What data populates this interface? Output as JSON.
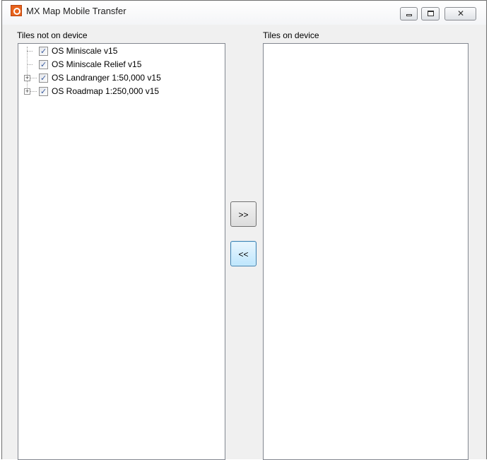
{
  "window": {
    "title": "MX Map Mobile Transfer",
    "icon": "app-icon",
    "controls": [
      "minimize-icon",
      "maximize-icon",
      "close-icon"
    ]
  },
  "left_panel": {
    "label": "Tiles not on device",
    "items": [
      {
        "label": "OS Miniscale v15",
        "checked": true,
        "expandable": false
      },
      {
        "label": "OS Miniscale Relief v15",
        "checked": true,
        "expandable": false
      },
      {
        "label": "OS Landranger 1:50,000 v15",
        "checked": true,
        "expandable": true
      },
      {
        "label": "OS Roadmap 1:250,000 v15",
        "checked": true,
        "expandable": true
      }
    ]
  },
  "right_panel": {
    "label": "Tiles on device",
    "items": []
  },
  "buttons": {
    "add_label": ">>",
    "remove_label": "<<"
  }
}
